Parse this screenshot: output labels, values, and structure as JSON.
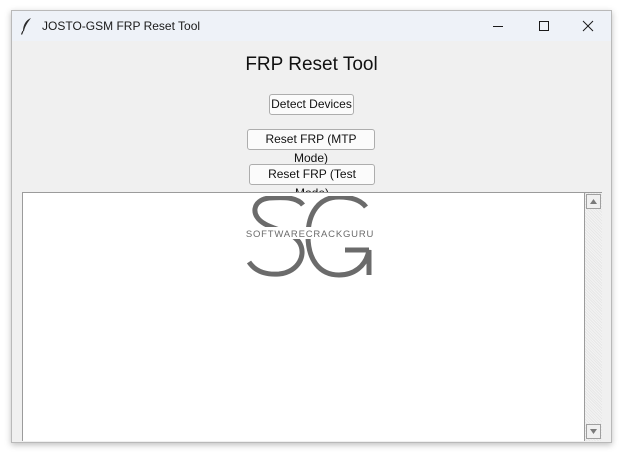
{
  "window": {
    "title": "JOSTO-GSM FRP Reset Tool",
    "icon": "feather-icon",
    "controls": [
      "minimize-icon",
      "maximize-icon",
      "close-icon"
    ]
  },
  "main": {
    "heading": "FRP Reset Tool",
    "buttons": {
      "detect_label": "Detect Devices",
      "mtp_label": "Reset FRP (MTP Mode)",
      "test_label": "Reset FRP (Test Mode)"
    },
    "output_text": ""
  },
  "watermark": {
    "letters": "SG",
    "text": "SOFTWARECRACKGURU"
  },
  "colors": {
    "window_bg": "#f0f0f0",
    "titlebar_bg": "#eef2f8",
    "watermark": "#6b6b6b"
  }
}
